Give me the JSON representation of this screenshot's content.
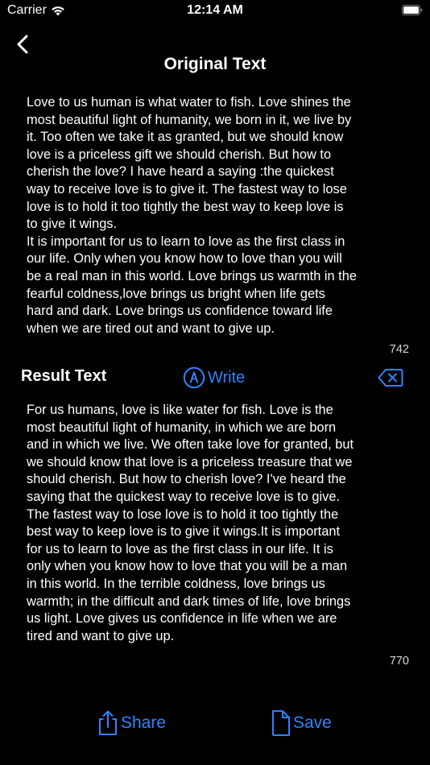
{
  "status_bar": {
    "carrier": "Carrier",
    "time": "12:14 AM"
  },
  "nav": {
    "title": "Original Text"
  },
  "original": {
    "text": "Love to us human is what water to fish. Love shines the\nmost beautiful light of humanity, we born in it, we live by\nit. Too often we take it as granted, but we should know\nlove is a priceless gift we should cherish. But how to\ncherish the love? I have heard a saying :the quickest\nway to receive love is to give it. The fastest way to lose\nlove is to hold it too tightly the best way to keep love is\nto give it wings.\nIt is important for us to learn to love as the first class in\nour life. Only when you know how to love than you will\nbe a real man in this world. Love brings us warmth in the\nfearful coldness,love brings us bright when life gets\nhard and dark. Love brings us confidence toward life\nwhen we are tired out and want to give up.",
    "count": "742"
  },
  "result": {
    "label": "Result Text",
    "write_label": "Write",
    "text": "For us humans, love is like water for fish. Love is the\nmost beautiful light of humanity, in which we are born\nand in which we live. We often take love for granted, but\nwe should know that love is a priceless treasure that we\nshould cherish. But how to cherish love? I've heard the\nsaying that the quickest way to receive love is to give.\nThe fastest way to lose love is to hold it too tightly the\nbest way to keep love is to give it wings.It is important\nfor us to learn to love as the first class in our life. It is\nonly when you know how to love that you will be a man\nin this world. In the terrible coldness, love brings us\nwarmth; in the difficult and dark times of life, love brings\nus light. Love gives us confidence in life when we are\ntired and want to give up.",
    "count": "770"
  },
  "actions": {
    "share_label": "Share",
    "save_label": "Save"
  },
  "colors": {
    "accent": "#2f83ff",
    "background": "#000000",
    "text": "#ffffff"
  },
  "icons": [
    "wifi-icon",
    "battery-icon",
    "back-chevron-icon",
    "pen-icon",
    "delete-icon",
    "share-icon",
    "document-icon"
  ]
}
